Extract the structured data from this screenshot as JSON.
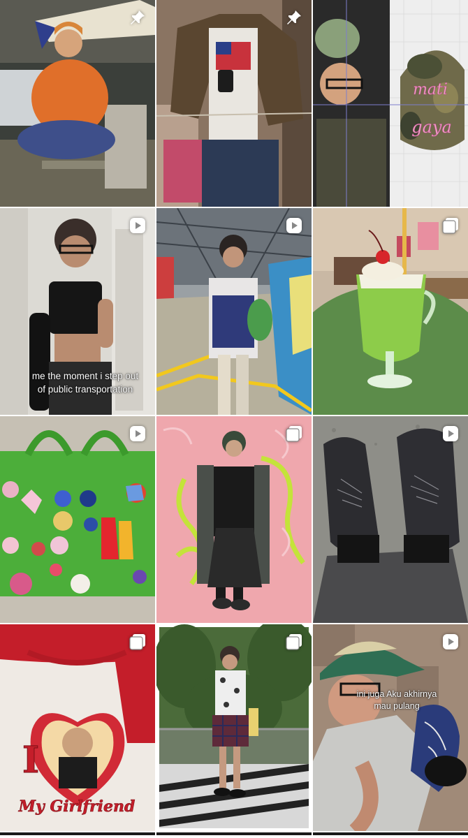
{
  "grid": {
    "posts": [
      {
        "kind": "pinned",
        "badge_icon": "pin-icon",
        "caption": ""
      },
      {
        "kind": "pinned",
        "badge_icon": "pin-icon",
        "caption": ""
      },
      {
        "kind": "photo",
        "badge_icon": "",
        "caption": "",
        "art_text": [
          "mati",
          "gaya"
        ]
      },
      {
        "kind": "reel",
        "badge_icon": "reel-icon",
        "caption": "me the moment i step out of public transportation"
      },
      {
        "kind": "reel",
        "badge_icon": "reel-icon",
        "caption": ""
      },
      {
        "kind": "carousel",
        "badge_icon": "carousel-icon",
        "caption": ""
      },
      {
        "kind": "reel",
        "badge_icon": "reel-icon",
        "caption": ""
      },
      {
        "kind": "carousel",
        "badge_icon": "carousel-icon",
        "caption": ""
      },
      {
        "kind": "reel",
        "badge_icon": "reel-icon",
        "caption": ""
      },
      {
        "kind": "carousel",
        "badge_icon": "carousel-icon",
        "caption": "",
        "art_text": [
          "I",
          "My Girlfriend"
        ]
      },
      {
        "kind": "carousel",
        "badge_icon": "carousel-icon",
        "caption": ""
      },
      {
        "kind": "reel",
        "badge_icon": "reel-icon",
        "caption": "ini juga Aku akhirnya mau pulang"
      }
    ]
  },
  "colors": {
    "background": "#ffffff",
    "badge": "#ffffff"
  }
}
